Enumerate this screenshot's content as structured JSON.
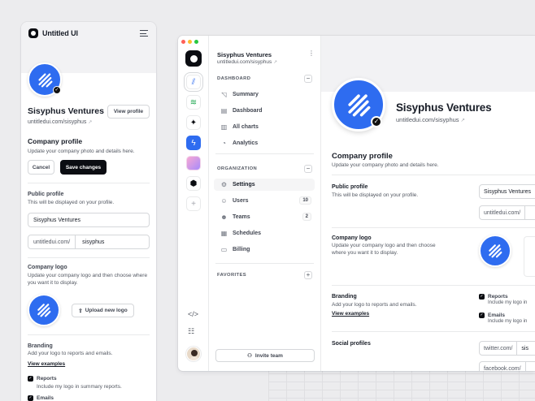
{
  "colors": {
    "brand_blue": "#2E6CF0",
    "dark": "#0B0D12",
    "canvas": "#ECECEE",
    "hero": "#F2F2F4"
  },
  "company": {
    "name": "Sisyphus Ventures",
    "url": "untitledui.com/sisyphus",
    "url_prefix": "untitledui.com/",
    "slug": "sisyphus"
  },
  "mobile": {
    "brand": "Untitled UI",
    "menu_icon": "hamburger-menu-icon",
    "view_profile": "View profile",
    "company_profile_title": "Company profile",
    "company_profile_sub": "Update your company photo and details here.",
    "cancel": "Cancel",
    "save": "Save changes",
    "public_profile_label": "Public profile",
    "public_profile_sub": "This will be displayed on your profile.",
    "company_logo_label": "Company logo",
    "company_logo_sub": "Update your company logo and then choose where you want it to display.",
    "upload_logo": "Upload new logo",
    "branding_label": "Branding",
    "branding_sub": "Add your logo to reports and emails.",
    "view_examples": "View examples",
    "reports_label": "Reports",
    "reports_sub": "Include my logo in summary reports.",
    "emails_label": "Emails"
  },
  "desktop": {
    "workspace_name": "Sisyphus Ventures",
    "workspace_url": "untitledui.com/sisyphus",
    "dashboard_heading": "DASHBOARD",
    "dashboard_items": [
      {
        "label": "Summary",
        "icon": "line-chart-icon"
      },
      {
        "label": "Dashboard",
        "icon": "bar-chart-icon"
      },
      {
        "label": "All charts",
        "icon": "columns-icon"
      },
      {
        "label": "Analytics",
        "icon": "pie-chart-icon"
      }
    ],
    "organization_heading": "ORGANIZATION",
    "organization_items": [
      {
        "label": "Settings",
        "icon": "gear-icon",
        "active": true
      },
      {
        "label": "Users",
        "icon": "users-icon",
        "count": "10"
      },
      {
        "label": "Teams",
        "icon": "team-icon",
        "count": "2"
      },
      {
        "label": "Schedules",
        "icon": "calendar-icon"
      },
      {
        "label": "Billing",
        "icon": "credit-card-icon"
      }
    ],
    "favorites_heading": "FAVORITES",
    "invite": "Invite team",
    "company_profile_title": "Company profile",
    "company_profile_sub": "Update your company photo and details here.",
    "public_profile_label": "Public profile",
    "public_profile_sub": "This will be displayed on your profile.",
    "company_logo_label": "Company logo",
    "company_logo_sub": "Update your company logo and then choose where you want it to display.",
    "branding_label": "Branding",
    "branding_sub": "Add your logo to reports and emails.",
    "view_examples": "View examples",
    "reports_label": "Reports",
    "reports_sub": "Include my logo in",
    "emails_label": "Emails",
    "emails_sub": "Include my logo in",
    "social_label": "Social profiles",
    "twitter_prefix": "twitter.com/",
    "twitter_value": "sis",
    "facebook_prefix": "facebook.com/"
  }
}
